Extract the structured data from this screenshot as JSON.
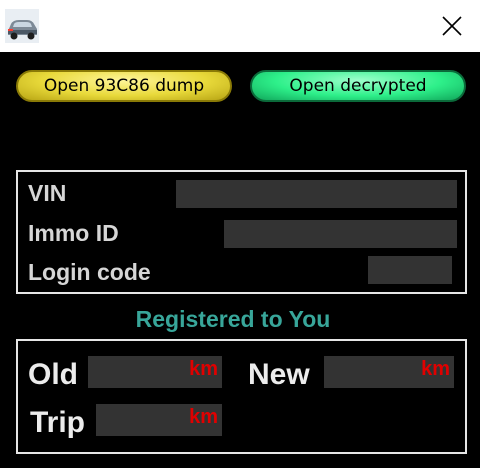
{
  "window": {
    "app_icon": "car-icon",
    "close_icon": "close-icon"
  },
  "buttons": {
    "open_dump_label": "Open 93C86 dump",
    "open_decrypted_label": "Open decrypted"
  },
  "vehicle_info": {
    "vin_label": "VIN",
    "vin_value": "",
    "immo_id_label": "Immo ID",
    "immo_id_value": "",
    "login_code_label": "Login code",
    "login_code_value": ""
  },
  "registration": {
    "text": "Registered to You"
  },
  "odometer": {
    "old_label": "Old",
    "old_value": "",
    "new_label": "New",
    "new_value": "",
    "trip_label": "Trip",
    "trip_value": "",
    "unit": "km"
  },
  "colors": {
    "background": "#000000",
    "titlebar": "#ffffff",
    "yellow_button": "#e8d93a",
    "green_button": "#2ef08a",
    "field": "#333333",
    "unit_text": "#e00000",
    "registered_text": "#38a69a"
  }
}
